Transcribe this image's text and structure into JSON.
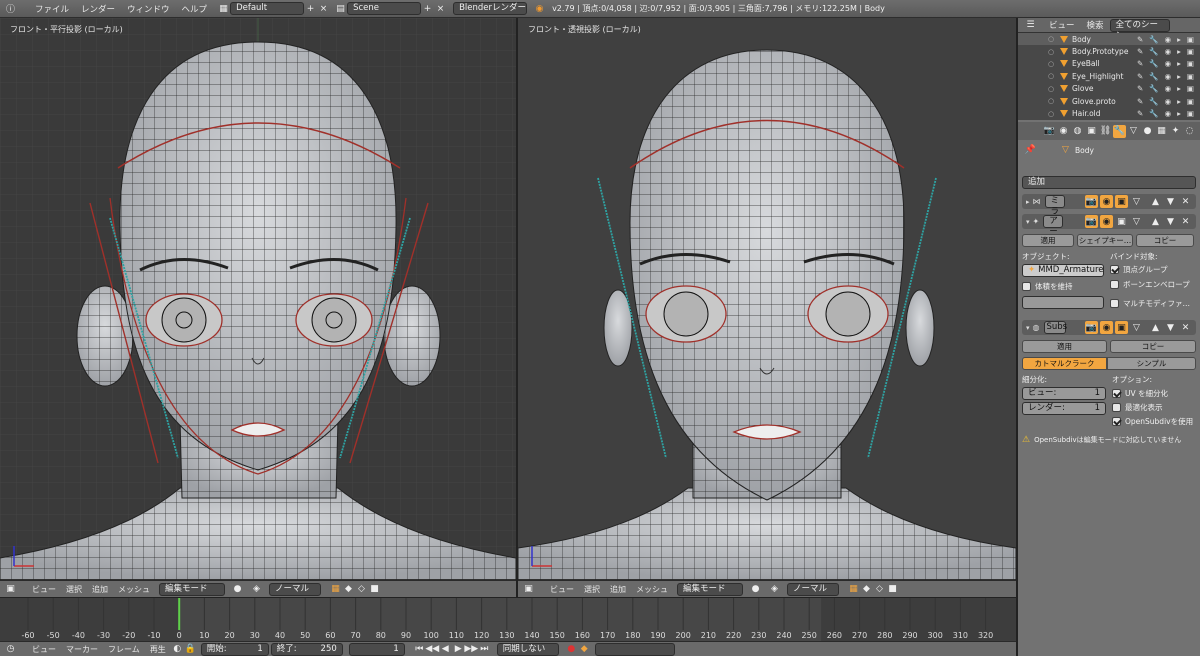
{
  "topbar": {
    "menus": [
      "ファイル",
      "レンダー",
      "ウィンドウ",
      "ヘルプ"
    ],
    "screen_layout": "Default",
    "scene": "Scene",
    "render_engine": "Blenderレンダー",
    "stats": "v2.79 | 頂点:0/4,058 | 辺:0/7,952 | 面:0/3,905 | 三角面:7,796 | メモリ:122.25M | Body"
  },
  "viewport_left": {
    "label": "フロント・平行投影 (ローカル)"
  },
  "viewport_right": {
    "label": "フロント・透視投影 (ローカル)"
  },
  "view_header": {
    "menus": [
      "ビュー",
      "選択",
      "追加",
      "メッシュ"
    ],
    "mode": "編集モード",
    "pivot": "ノーマル"
  },
  "timeline": {
    "ticks": [
      "-60",
      "-50",
      "-40",
      "-30",
      "-20",
      "-10",
      "0",
      "10",
      "20",
      "30",
      "40",
      "50",
      "60",
      "70",
      "80",
      "90",
      "100",
      "110",
      "120",
      "130",
      "140",
      "150",
      "160",
      "170",
      "180",
      "190",
      "200",
      "210",
      "220",
      "230",
      "240",
      "250",
      "260",
      "270",
      "280",
      "290",
      "300",
      "310",
      "320"
    ],
    "current_frame_value": 0,
    "menus": [
      "ビュー",
      "マーカー",
      "フレーム",
      "再生"
    ],
    "start_label": "開始:",
    "start_value": "1",
    "end_label": "終了:",
    "end_value": "250",
    "current": "1",
    "sync": "同期しない"
  },
  "outliner": {
    "view": "ビュー",
    "search": "検索",
    "scope": "全てのシーン",
    "items": [
      "Body",
      "Body.Prototype",
      "EyeBall",
      "Eye_Highlight",
      "Glove",
      "Glove.proto",
      "Hair.old"
    ]
  },
  "properties": {
    "object_name": "Body",
    "add_modifier": "追加",
    "mod1_name": "ミラ",
    "mod2_name": "アー",
    "mod2_apply": "適用",
    "mod2_shapekey": "シェイプキー…",
    "mod2_copy": "コピー",
    "object_label": "オブジェクト:",
    "object_value": "MMD_Armature",
    "bind_label": "バインド対象:",
    "vertex_groups": "頂点グループ",
    "preserve_volume": "体積を維持",
    "bone_envelopes": "ボーンエンベロープ",
    "multi_modifier": "マルチモディファ…",
    "mod3_name": "Subs",
    "mod3_apply": "適用",
    "mod3_copy": "コピー",
    "tab_catmull": "カトマルクラーク",
    "tab_simple": "シンプル",
    "subdiv_label": "細分化:",
    "view_label": "ビュー:",
    "view_value": "1",
    "render_label": "レンダー:",
    "render_value": "1",
    "options_label": "オプション:",
    "opt_uv": "UV を細分化",
    "opt_optimal": "最適化表示",
    "opt_opensubdiv": "OpenSubdivを使用",
    "warning": "OpenSubdivは編集モードに対応していません"
  }
}
